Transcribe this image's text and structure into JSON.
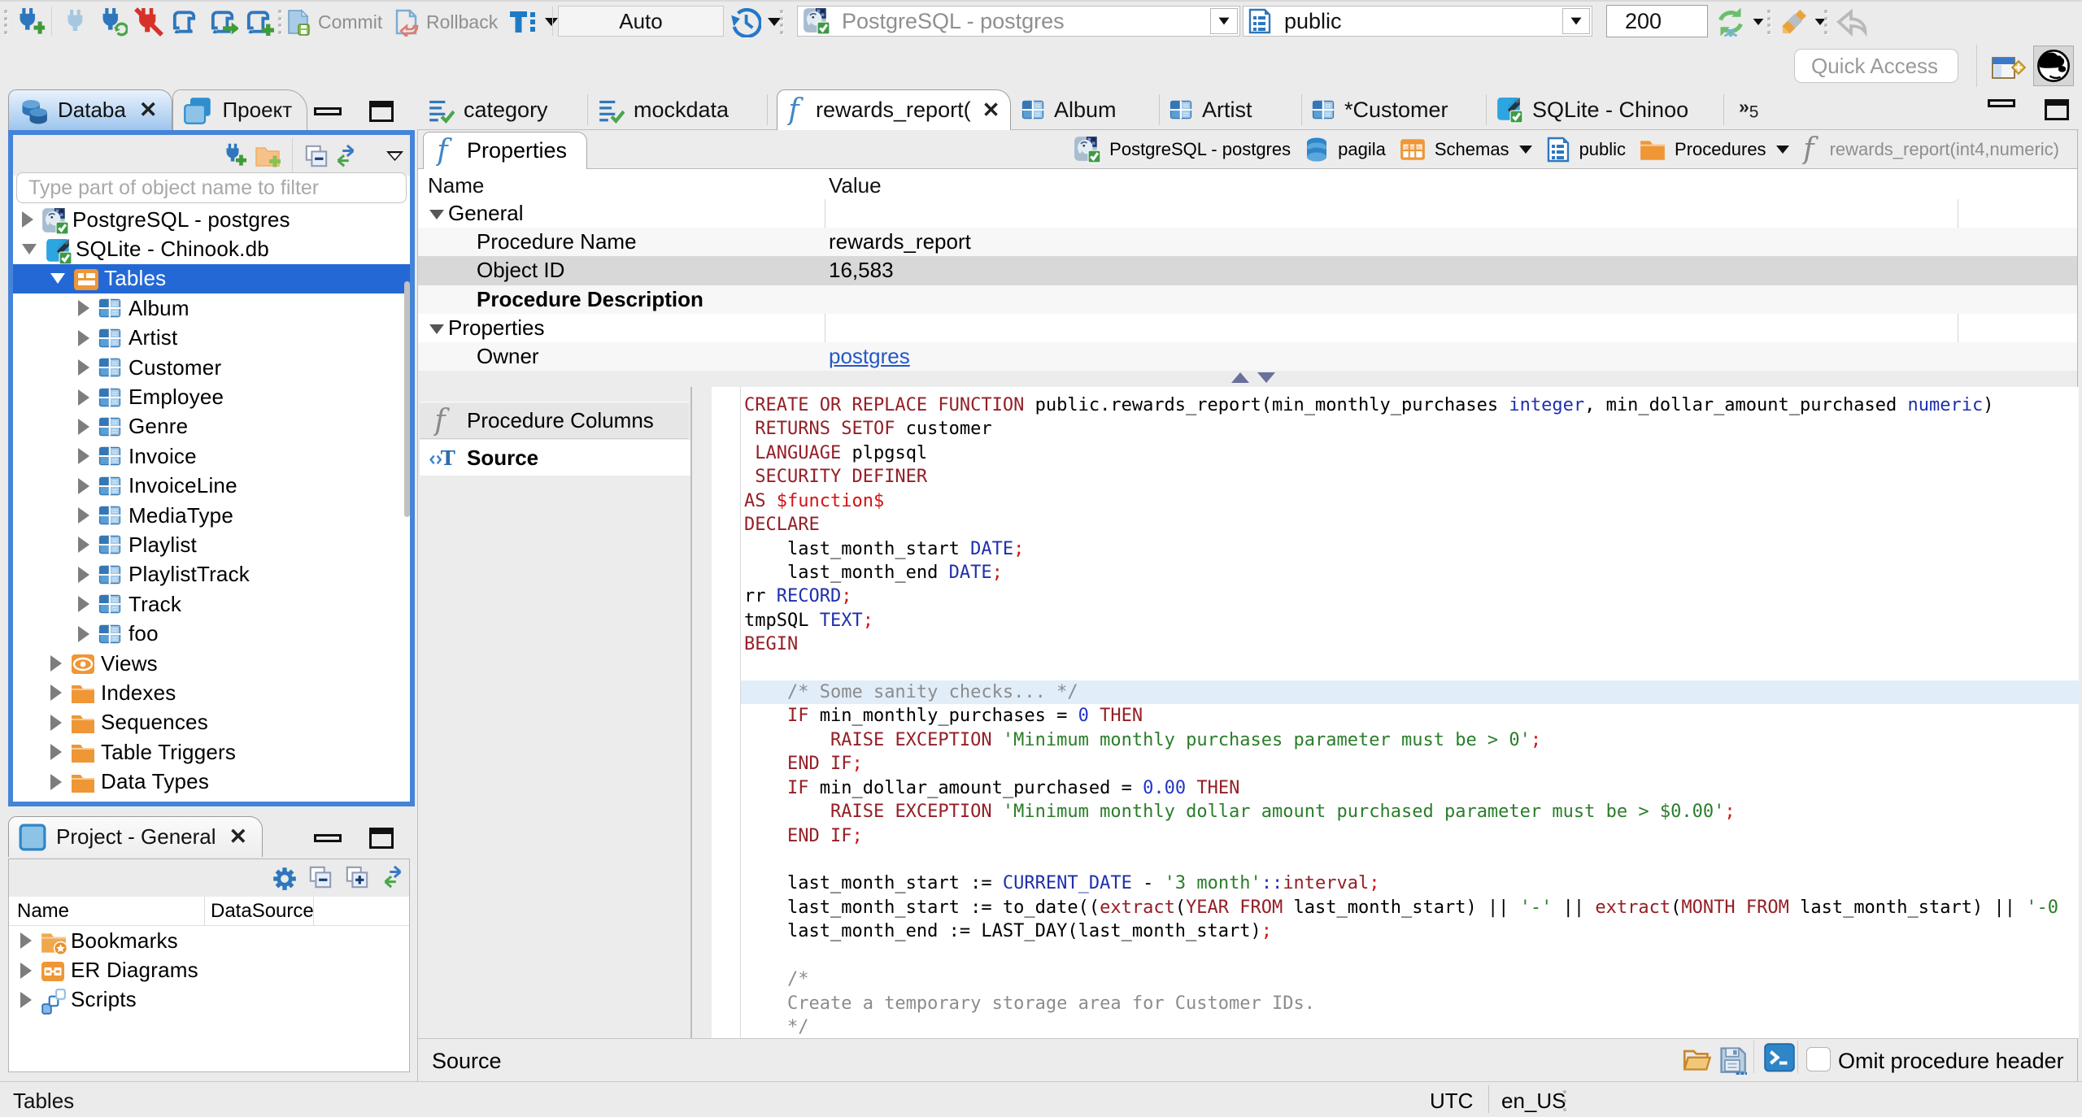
{
  "toolbar": {
    "commit_label": "Commit",
    "rollback_label": "Rollback",
    "auto_label": "Auto",
    "datasource_value": "PostgreSQL - postgres",
    "schema_value": "public",
    "fetch_size_value": "200",
    "icons": [
      "new-connection-icon",
      "connect-icon",
      "reconnect-icon",
      "disconnect-icon",
      "sql-editor-icon",
      "open-sql-script-icon",
      "new-sql-editor-icon",
      "commit-icon",
      "rollback-icon",
      "transaction-mode-icon",
      "transaction-log-icon",
      "refresh-icon",
      "sql-generator-icon",
      "back-icon"
    ]
  },
  "quick_access": {
    "placeholder": "Quick Access"
  },
  "nav": {
    "tabs": [
      {
        "label": "Databa",
        "closable": true,
        "active": true
      },
      {
        "label": "Проект",
        "closable": false,
        "active": false
      }
    ],
    "filter_placeholder": "Type part of object name to filter",
    "tree": [
      {
        "level": 1,
        "arrow": "right",
        "icon": "postgres-db-icon",
        "label": "PostgreSQL - postgres",
        "selected": false
      },
      {
        "level": 1,
        "arrow": "down",
        "icon": "sqlite-db-icon",
        "label": "SQLite - Chinook.db",
        "selected": false
      },
      {
        "level": 2,
        "arrow": "down",
        "icon": "tables-folder-icon",
        "label": "Tables",
        "selected": true
      },
      {
        "level": 3,
        "arrow": "right",
        "icon": "table-icon",
        "label": "Album",
        "selected": false
      },
      {
        "level": 3,
        "arrow": "right",
        "icon": "table-icon",
        "label": "Artist",
        "selected": false
      },
      {
        "level": 3,
        "arrow": "right",
        "icon": "table-icon",
        "label": "Customer",
        "selected": false
      },
      {
        "level": 3,
        "arrow": "right",
        "icon": "table-icon",
        "label": "Employee",
        "selected": false
      },
      {
        "level": 3,
        "arrow": "right",
        "icon": "table-icon",
        "label": "Genre",
        "selected": false
      },
      {
        "level": 3,
        "arrow": "right",
        "icon": "table-icon",
        "label": "Invoice",
        "selected": false
      },
      {
        "level": 3,
        "arrow": "right",
        "icon": "table-icon",
        "label": "InvoiceLine",
        "selected": false
      },
      {
        "level": 3,
        "arrow": "right",
        "icon": "table-icon",
        "label": "MediaType",
        "selected": false
      },
      {
        "level": 3,
        "arrow": "right",
        "icon": "table-icon",
        "label": "Playlist",
        "selected": false
      },
      {
        "level": 3,
        "arrow": "right",
        "icon": "table-icon",
        "label": "PlaylistTrack",
        "selected": false
      },
      {
        "level": 3,
        "arrow": "right",
        "icon": "table-icon",
        "label": "Track",
        "selected": false
      },
      {
        "level": 3,
        "arrow": "right",
        "icon": "table-icon",
        "label": "foo",
        "selected": false
      },
      {
        "level": 2,
        "arrow": "right",
        "icon": "views-icon",
        "label": "Views",
        "selected": false
      },
      {
        "level": 2,
        "arrow": "right",
        "icon": "folder-icon",
        "label": "Indexes",
        "selected": false
      },
      {
        "level": 2,
        "arrow": "right",
        "icon": "folder-icon",
        "label": "Sequences",
        "selected": false
      },
      {
        "level": 2,
        "arrow": "right",
        "icon": "folder-icon",
        "label": "Table Triggers",
        "selected": false
      },
      {
        "level": 2,
        "arrow": "right",
        "icon": "folder-icon",
        "label": "Data Types",
        "selected": false
      }
    ]
  },
  "project": {
    "tab_label": "Project - General",
    "columns": [
      "Name",
      "DataSource"
    ],
    "rows": [
      {
        "icon": "bookmarks-folder-icon",
        "label": "Bookmarks"
      },
      {
        "icon": "er-diagrams-icon",
        "label": "ER Diagrams"
      },
      {
        "icon": "scripts-icon",
        "label": "Scripts"
      }
    ]
  },
  "editor": {
    "tabs": [
      {
        "icon": "sql-script-icon",
        "label": "category",
        "close": false,
        "active": false
      },
      {
        "icon": "sql-script-icon",
        "label": "mockdata",
        "close": false,
        "active": false
      },
      {
        "icon": "function-icon",
        "label": "rewards_report(",
        "close": true,
        "active": true
      },
      {
        "icon": "table-icon",
        "label": "Album",
        "close": false,
        "active": false
      },
      {
        "icon": "table-icon",
        "label": "Artist",
        "close": false,
        "active": false
      },
      {
        "icon": "table-icon",
        "label": "*Customer",
        "close": false,
        "active": false
      },
      {
        "icon": "sqlite-db-icon",
        "label": "SQLite - Chinoo",
        "close": false,
        "active": false
      }
    ],
    "overflow_count": "5"
  },
  "properties_view": {
    "tab_label": "Properties",
    "breadcrumb": [
      {
        "icon": "postgres-db-icon",
        "label": "PostgreSQL - postgres",
        "caret": false,
        "dim": false
      },
      {
        "icon": "database-icon",
        "label": "pagila",
        "caret": false,
        "dim": false
      },
      {
        "icon": "schemas-icon",
        "label": "Schemas",
        "caret": true,
        "dim": false
      },
      {
        "icon": "schema-doc-icon",
        "label": "public",
        "caret": false,
        "dim": false
      },
      {
        "icon": "procedures-folder-icon",
        "label": "Procedures",
        "caret": true,
        "dim": false
      },
      {
        "icon": "function-grey-icon",
        "label": "rewards_report(int4,numeric)",
        "caret": false,
        "dim": true
      }
    ],
    "columns": [
      "Name",
      "Value"
    ],
    "rows": [
      {
        "group": true,
        "label": "General",
        "value": "",
        "bold": false,
        "selected": false,
        "link": false
      },
      {
        "group": false,
        "label": "Procedure Name",
        "value": "rewards_report",
        "bold": false,
        "selected": false,
        "link": false
      },
      {
        "group": false,
        "label": "Object ID",
        "value": "16,583",
        "bold": false,
        "selected": true,
        "link": false
      },
      {
        "group": false,
        "label": "Procedure Description",
        "value": "",
        "bold": true,
        "selected": false,
        "link": false
      },
      {
        "group": true,
        "label": "Properties",
        "value": "",
        "bold": false,
        "selected": false,
        "link": false
      },
      {
        "group": false,
        "label": "Owner",
        "value": "postgres",
        "bold": false,
        "selected": false,
        "link": true
      }
    ]
  },
  "pages": [
    {
      "icon": "function-grey-icon",
      "label": "Procedure Columns",
      "active": false
    },
    {
      "icon": "source-icon",
      "label": "Source",
      "active": true
    }
  ],
  "code": {
    "highlight_line": 12,
    "lines": [
      [
        [
          "kw",
          "CREATE OR REPLACE FUNCTION"
        ],
        [
          "pl",
          " public.rewards_report(min_monthly_purchases "
        ],
        [
          "ty",
          "integer"
        ],
        [
          "pl",
          ", min_dollar_amount_purchased "
        ],
        [
          "ty",
          "numeric"
        ],
        [
          "pl",
          ")"
        ]
      ],
      [
        [
          "pl",
          " "
        ],
        [
          "kw",
          "RETURNS SETOF"
        ],
        [
          "pl",
          " customer"
        ]
      ],
      [
        [
          "pl",
          " "
        ],
        [
          "kw",
          "LANGUAGE"
        ],
        [
          "pl",
          " plpgsql"
        ]
      ],
      [
        [
          "pl",
          " "
        ],
        [
          "kw",
          "SECURITY DEFINER"
        ]
      ],
      [
        [
          "kw",
          "AS"
        ],
        [
          "rd",
          " $function$"
        ]
      ],
      [
        [
          "kw",
          "DECLARE"
        ]
      ],
      [
        [
          "pl",
          "    last_month_start "
        ],
        [
          "ty",
          "DATE"
        ],
        [
          "rd",
          ";"
        ]
      ],
      [
        [
          "pl",
          "    last_month_end "
        ],
        [
          "ty",
          "DATE"
        ],
        [
          "rd",
          ";"
        ]
      ],
      [
        [
          "pl",
          "rr "
        ],
        [
          "ty",
          "RECORD"
        ],
        [
          "rd",
          ";"
        ]
      ],
      [
        [
          "pl",
          "tmpSQL "
        ],
        [
          "ty",
          "TEXT"
        ],
        [
          "rd",
          ";"
        ]
      ],
      [
        [
          "kw",
          "BEGIN"
        ]
      ],
      [],
      [
        [
          "pl",
          "    "
        ],
        [
          "cm",
          "/* Some sanity checks... */"
        ]
      ],
      [
        [
          "pl",
          "    "
        ],
        [
          "kw",
          "IF"
        ],
        [
          "pl",
          " min_monthly_purchases = "
        ],
        [
          "nm",
          "0"
        ],
        [
          "pl",
          " "
        ],
        [
          "kw",
          "THEN"
        ]
      ],
      [
        [
          "pl",
          "        "
        ],
        [
          "kw",
          "RAISE EXCEPTION"
        ],
        [
          "pl",
          " "
        ],
        [
          "st",
          "'Minimum monthly purchases parameter must be > 0'"
        ],
        [
          "rd",
          ";"
        ]
      ],
      [
        [
          "pl",
          "    "
        ],
        [
          "kw",
          "END IF"
        ],
        [
          "rd",
          ";"
        ]
      ],
      [
        [
          "pl",
          "    "
        ],
        [
          "kw",
          "IF"
        ],
        [
          "pl",
          " min_dollar_amount_purchased = "
        ],
        [
          "nm",
          "0.00"
        ],
        [
          "pl",
          " "
        ],
        [
          "kw",
          "THEN"
        ]
      ],
      [
        [
          "pl",
          "        "
        ],
        [
          "kw",
          "RAISE EXCEPTION"
        ],
        [
          "pl",
          " "
        ],
        [
          "st",
          "'Minimum monthly dollar amount purchased parameter must be > $0.00'"
        ],
        [
          "rd",
          ";"
        ]
      ],
      [
        [
          "pl",
          "    "
        ],
        [
          "kw",
          "END IF"
        ],
        [
          "rd",
          ";"
        ]
      ],
      [],
      [
        [
          "pl",
          "    last_month_start := "
        ],
        [
          "ty",
          "CURRENT_DATE"
        ],
        [
          "pl",
          " - "
        ],
        [
          "st",
          "'3 month'"
        ],
        [
          "ty",
          "::"
        ],
        [
          "kw",
          "interval"
        ],
        [
          "rd",
          ";"
        ]
      ],
      [
        [
          "pl",
          "    last_month_start := to_date(("
        ],
        [
          "kw",
          "extract"
        ],
        [
          "pl",
          "("
        ],
        [
          "kw",
          "YEAR FROM"
        ],
        [
          "pl",
          " last_month_start) || "
        ],
        [
          "st",
          "'-'"
        ],
        [
          "pl",
          " || "
        ],
        [
          "kw",
          "extract"
        ],
        [
          "pl",
          "("
        ],
        [
          "kw",
          "MONTH FROM"
        ],
        [
          "pl",
          " last_month_start) || "
        ],
        [
          "st",
          "'-0"
        ]
      ],
      [
        [
          "pl",
          "    last_month_end := LAST_DAY(last_month_start)"
        ],
        [
          "rd",
          ";"
        ]
      ],
      [],
      [
        [
          "pl",
          "    "
        ],
        [
          "cm",
          "/*"
        ]
      ],
      [
        [
          "pl",
          "    "
        ],
        [
          "cm",
          "Create a temporary storage area for Customer IDs."
        ]
      ],
      [
        [
          "pl",
          "    "
        ],
        [
          "cm",
          "*/"
        ]
      ]
    ]
  },
  "editor_footer": {
    "label": "Source",
    "omit_label": "Omit procedure header",
    "icons": [
      "open-file-icon",
      "save-icon",
      "terminal-icon"
    ]
  },
  "statusbar": {
    "left": "Tables",
    "timezone": "UTC",
    "locale": "en_US"
  },
  "colors": {
    "selection_blue": "#2468d5",
    "focus_border": "#4584d8",
    "keyword": "#8f1a2a",
    "string": "#2a7d2a",
    "number": "#2135c8",
    "datatype": "#1f2fae",
    "comment": "#8c8c8c",
    "punct_red": "#d21414",
    "link": "#2458c6"
  }
}
